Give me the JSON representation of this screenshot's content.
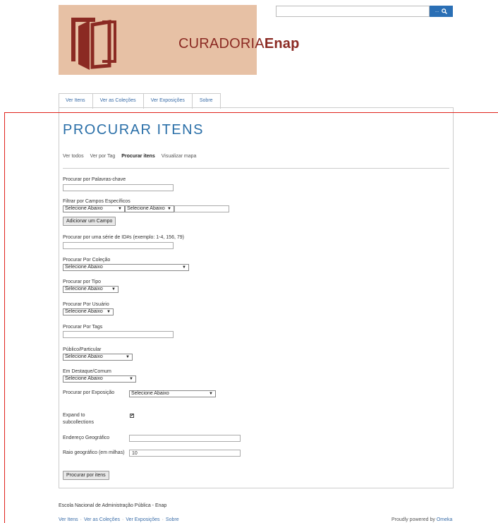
{
  "logo": {
    "text_light": "CURADORIA",
    "text_bold": "Enap"
  },
  "search": {
    "placeholder": "",
    "button_dots": "...",
    "icon": "search-icon"
  },
  "nav": [
    "Ver Itens",
    "Ver as Coleções",
    "Ver Exposições",
    "Sobre"
  ],
  "page": {
    "title": "PROCURAR ITENS",
    "subnav": [
      "Ver todos",
      "Ver por Tag",
      "Procurar itens",
      "Visualizar mapa"
    ],
    "subnav_active": "Procurar itens"
  },
  "form": {
    "keyword_label": "Procurar por Palavras-chave",
    "keyword_value": "",
    "specific_label": "Filtrar por Campos Específicos",
    "specific_field_select": "Selecione Abaixo",
    "specific_type_select": "Selecione Abaixo",
    "specific_value": "",
    "add_field_button": "Adicionar um Campo",
    "range_label": "Procurar por uma série de ID#s (exemplo: 1-4, 156, 79)",
    "range_value": "",
    "collection_label": "Procurar Por Coleção",
    "collection_select": "Selecione Abaixo",
    "type_label": "Procurar por Tipo",
    "type_select": "Selecione Abaixo",
    "user_label": "Procurar Por Usuário",
    "user_select": "Selecione Abaixo",
    "tags_label": "Procurar Por Tags",
    "tags_value": "",
    "public_label": "Público/Particular",
    "public_select": "Selecione Abaixo",
    "featured_label": "Em Destaque/Comum",
    "featured_select": "Selecione Abaixo",
    "exhibit_label": "Procurar por Exposição",
    "exhibit_select": "Selecione Abaixo",
    "expand_label": "Expand to subcollections",
    "expand_checked": true,
    "address_label": "Endereço Geográfico",
    "address_value": "",
    "radius_label": "Raio geográfico (em milhas)",
    "radius_value": "10",
    "submit_button": "Procurar por itens"
  },
  "footer": {
    "org": "Escola Nacional de Administração Pública - Enap",
    "nav": [
      "Ver Itens",
      "Ver as Coleções",
      "Ver Exposições",
      "Sobre"
    ],
    "nav_separator": "·",
    "powered_prefix": "Proudly powered by ",
    "powered_link": "Omeka"
  },
  "colors": {
    "accent": "#2a6fa8",
    "logo_bg": "#e7c1a5",
    "logo_text": "#8b2a23",
    "frame": "#e0231c"
  }
}
